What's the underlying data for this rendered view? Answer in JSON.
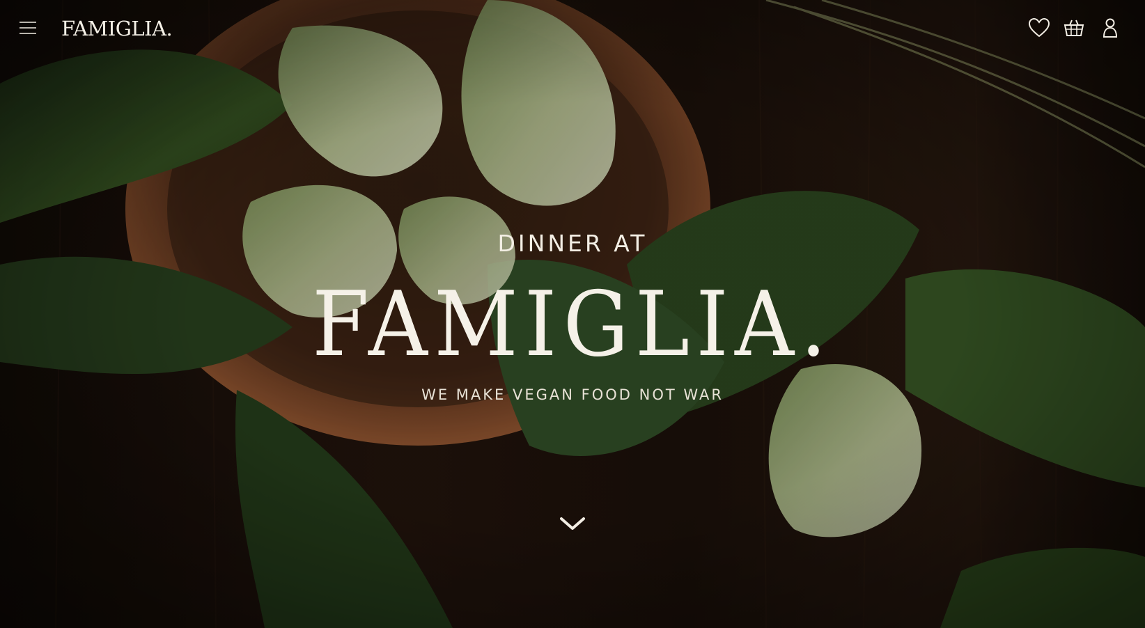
{
  "header": {
    "logo_text": "FAMIGLIA.",
    "menu_icon": "hamburger-menu-icon",
    "wishlist_icon": "heart-icon",
    "basket_icon": "basket-icon",
    "account_icon": "user-icon"
  },
  "hero": {
    "kicker": "DINNER AT",
    "title": "FAMIGLIA.",
    "tagline": "WE MAKE VEGAN FOOD NOT WAR",
    "scroll_icon": "chevron-down-icon"
  },
  "colors": {
    "text": "#f3eee4",
    "background": "#160f0a",
    "leaf_dark": "#2f4a1d",
    "leaf_light": "#9fba74",
    "wood": "#7a4427"
  }
}
